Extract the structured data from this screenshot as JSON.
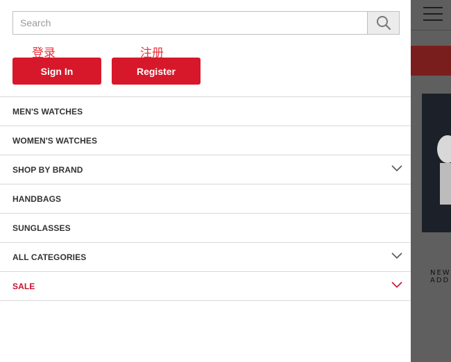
{
  "search": {
    "placeholder": "Search"
  },
  "auth": {
    "sign_in_annotation": "登录",
    "sign_in_label": "Sign In",
    "register_annotation": "注册",
    "register_label": "Register"
  },
  "menu": {
    "items": [
      {
        "label": "MEN'S WATCHES",
        "expandable": false
      },
      {
        "label": "WOMEN'S WATCHES",
        "expandable": false
      },
      {
        "label": "SHOP BY BRAND",
        "expandable": true
      },
      {
        "label": "HANDBAGS",
        "expandable": false
      },
      {
        "label": "SUNGLASSES",
        "expandable": false
      },
      {
        "label": "ALL CATEGORIES",
        "expandable": true
      },
      {
        "label": "SALE",
        "expandable": true,
        "highlight": true
      }
    ]
  },
  "background": {
    "caption_line1": "NEW",
    "caption_line2": "ADD"
  },
  "colors": {
    "brand_red": "#d7182a",
    "sale_red": "#c8102e",
    "annotation_red": "#e8333b"
  }
}
